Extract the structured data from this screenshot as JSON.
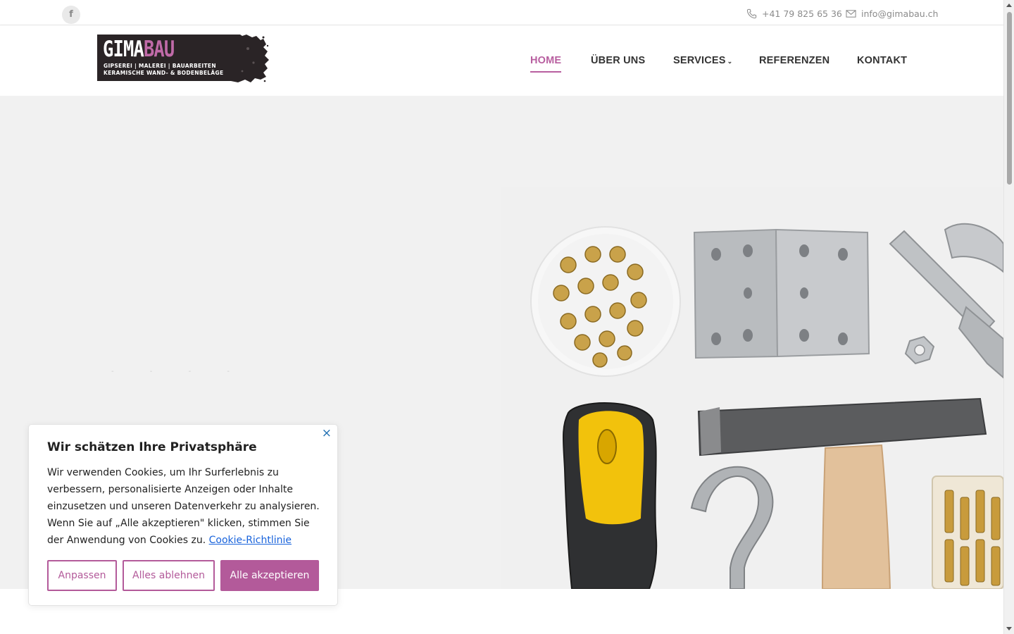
{
  "topbar": {
    "phone": "+41 79 825 65 36",
    "email": "info@gimabau.ch",
    "social_icon": "facebook-icon"
  },
  "logo": {
    "word_part1": "GIMA",
    "word_part2": "BAU",
    "line1": "GIPSEREI | MALEREI | BAUARBEITEN",
    "line2": "KERAMISCHE WAND- & BODENBELÄGE"
  },
  "nav": {
    "items": [
      {
        "label": "HOME"
      },
      {
        "label": "ÜBER UNS"
      },
      {
        "label": "SERVICES"
      },
      {
        "label": "REFERENZEN"
      },
      {
        "label": "KONTAKT"
      }
    ]
  },
  "cookie": {
    "title": "Wir schätzen Ihre Privatsphäre",
    "text": "Wir verwenden Cookies, um Ihr Surferlebnis zu verbessern, personalisierte Anzeigen oder Inhalte einzusetzen und unseren Datenverkehr zu analysieren. Wenn Sie auf „Alle akzeptieren\" klicken, stimmen Sie der Anwendung von Cookies zu.",
    "link": "Cookie-Richtlinie",
    "btn_customize": "Anpassen",
    "btn_reject": "Alles ablehnen",
    "btn_accept": "Alle akzeptieren"
  },
  "colors": {
    "accent": "#b85fa0",
    "logo_bg": "#2a2426",
    "link": "#1863dc"
  }
}
